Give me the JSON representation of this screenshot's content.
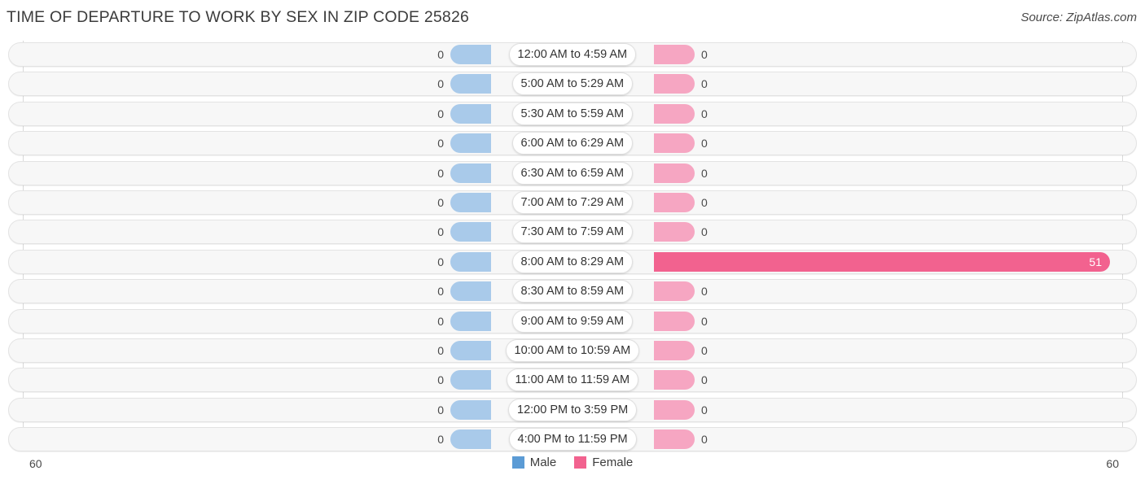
{
  "header": {
    "title": "TIME OF DEPARTURE TO WORK BY SEX IN ZIP CODE 25826",
    "source": "Source: ZipAtlas.com"
  },
  "legend": {
    "male_label": "Male",
    "female_label": "Female",
    "male_color": "#5b9bd5",
    "female_color": "#f2628f"
  },
  "axis": {
    "left_tick": "60",
    "right_tick": "60"
  },
  "chart_data": {
    "type": "bar",
    "title": "TIME OF DEPARTURE TO WORK BY SEX IN ZIP CODE 25826",
    "subtitle": "Source: ZipAtlas.com",
    "orientation": "horizontal-diverging",
    "xlabel": "",
    "ylabel": "",
    "xlim": [
      -60,
      60
    ],
    "axis_ticks": [
      "60",
      "60"
    ],
    "grid": false,
    "legend_position": "bottom-center",
    "categories": [
      "12:00 AM to 4:59 AM",
      "5:00 AM to 5:29 AM",
      "5:30 AM to 5:59 AM",
      "6:00 AM to 6:29 AM",
      "6:30 AM to 6:59 AM",
      "7:00 AM to 7:29 AM",
      "7:30 AM to 7:59 AM",
      "8:00 AM to 8:29 AM",
      "8:30 AM to 8:59 AM",
      "9:00 AM to 9:59 AM",
      "10:00 AM to 10:59 AM",
      "11:00 AM to 11:59 AM",
      "12:00 PM to 3:59 PM",
      "4:00 PM to 11:59 PM"
    ],
    "series": [
      {
        "name": "Male",
        "color": "#5b9bd5",
        "values": [
          0,
          0,
          0,
          0,
          0,
          0,
          0,
          0,
          0,
          0,
          0,
          0,
          0,
          0
        ]
      },
      {
        "name": "Female",
        "color": "#f2628f",
        "values": [
          0,
          0,
          0,
          0,
          0,
          0,
          0,
          51,
          0,
          0,
          0,
          0,
          0,
          0
        ]
      }
    ]
  },
  "rows": [
    {
      "label": "12:00 AM to 4:59 AM",
      "male": "0",
      "female": "0"
    },
    {
      "label": "5:00 AM to 5:29 AM",
      "male": "0",
      "female": "0"
    },
    {
      "label": "5:30 AM to 5:59 AM",
      "male": "0",
      "female": "0"
    },
    {
      "label": "6:00 AM to 6:29 AM",
      "male": "0",
      "female": "0"
    },
    {
      "label": "6:30 AM to 6:59 AM",
      "male": "0",
      "female": "0"
    },
    {
      "label": "7:00 AM to 7:29 AM",
      "male": "0",
      "female": "0"
    },
    {
      "label": "7:30 AM to 7:59 AM",
      "male": "0",
      "female": "0"
    },
    {
      "label": "8:00 AM to 8:29 AM",
      "male": "0",
      "female": "51"
    },
    {
      "label": "8:30 AM to 8:59 AM",
      "male": "0",
      "female": "0"
    },
    {
      "label": "9:00 AM to 9:59 AM",
      "male": "0",
      "female": "0"
    },
    {
      "label": "10:00 AM to 10:59 AM",
      "male": "0",
      "female": "0"
    },
    {
      "label": "11:00 AM to 11:59 AM",
      "male": "0",
      "female": "0"
    },
    {
      "label": "12:00 PM to 3:59 PM",
      "male": "0",
      "female": "0"
    },
    {
      "label": "4:00 PM to 11:59 PM",
      "male": "0",
      "female": "0"
    }
  ]
}
